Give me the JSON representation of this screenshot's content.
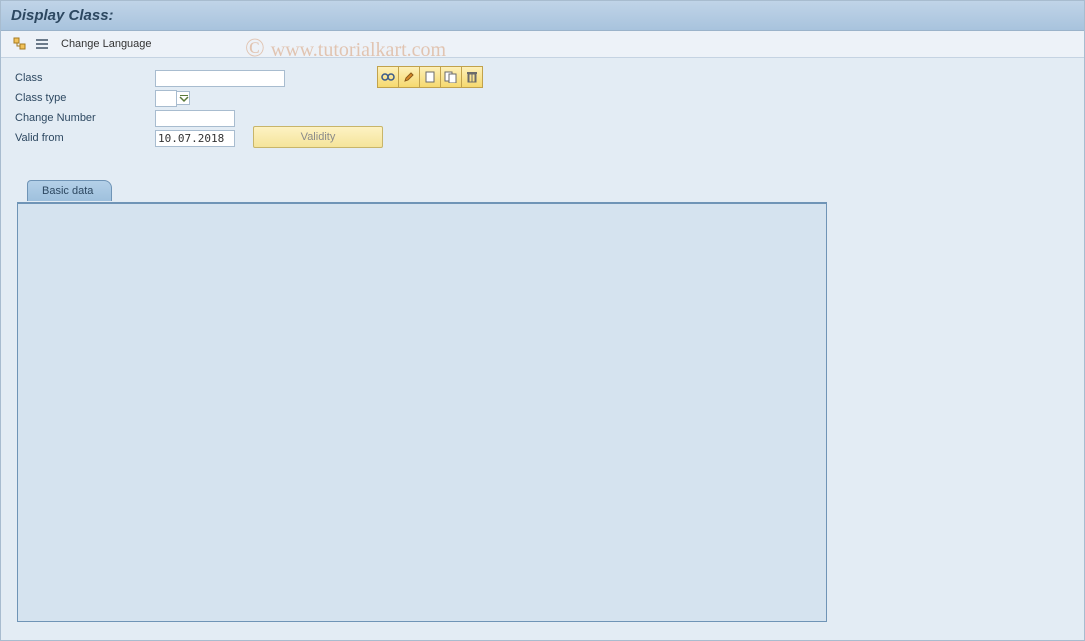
{
  "title": "Display Class:",
  "toolbar": {
    "change_language": "Change Language"
  },
  "fields": {
    "class_label": "Class",
    "class_value": "",
    "class_type_label": "Class type",
    "class_type_value": "",
    "change_number_label": "Change Number",
    "change_number_value": "",
    "valid_from_label": "Valid from",
    "valid_from_value": "10.07.2018"
  },
  "buttons": {
    "validity": "Validity"
  },
  "tabs": {
    "basic_data": "Basic data"
  },
  "watermark": "© www.tutorialkart.com"
}
